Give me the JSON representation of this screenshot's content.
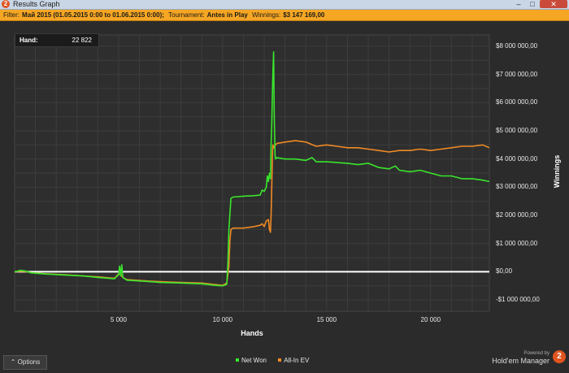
{
  "window": {
    "title": "Results Graph",
    "icon": "holdem-manager-icon"
  },
  "filterbar": {
    "filter_label": "Filter:",
    "filter_value": "Май 2015 (01.05.2015 0:00 to 01.06.2015 0:00);",
    "tournament_label": "Tournament:",
    "tournament_value": "Antes in Play",
    "winnings_label": "Winnings:",
    "winnings_value": "$3 147 169,00"
  },
  "hand_box": {
    "label": "Hand:",
    "value": "22 822"
  },
  "bottombar": {
    "options_label": "⌃  Options",
    "powered_small": "Powered by",
    "powered_brand": "Hold'em Manager",
    "logo_text": "2"
  },
  "colors": {
    "net_won": "#39e52c",
    "all_in_ev": "#f08a24",
    "accent": "#f5a623"
  },
  "chart_data": {
    "type": "line",
    "xlabel": "Hands",
    "ylabel": "Winnings",
    "xlim": [
      0,
      22822
    ],
    "ylim": [
      -1400000,
      8400000
    ],
    "x_ticks": [
      5000,
      10000,
      15000,
      20000
    ],
    "x_tick_labels": [
      "5 000",
      "10 000",
      "15 000",
      "20 000"
    ],
    "y_ticks": [
      -1000000,
      0,
      1000000,
      2000000,
      3000000,
      4000000,
      5000000,
      6000000,
      7000000,
      8000000
    ],
    "y_tick_labels": [
      "-$1 000 000,00",
      "$0,00",
      "$1 000 000,00",
      "$2 000 000,00",
      "$3 000 000,00",
      "$4 000 000,00",
      "$5 000 000,00",
      "$6 000 000,00",
      "$7 000 000,00",
      "$8 000 000,00"
    ],
    "grid": true,
    "legend_position": "bottom-center",
    "series": [
      {
        "name": "Net Won",
        "x": [
          0,
          300,
          500,
          800,
          1500,
          2500,
          3300,
          4000,
          4800,
          5000,
          5050,
          5100,
          5150,
          5200,
          5400,
          6500,
          7000,
          8000,
          9000,
          9600,
          10000,
          10200,
          10250,
          10300,
          10400,
          10500,
          11000,
          11500,
          11800,
          11900,
          12000,
          12100,
          12150,
          12200,
          12250,
          12300,
          12330,
          12360,
          12390,
          12420,
          12450,
          12480,
          12520,
          12550,
          12600,
          13000,
          13500,
          14000,
          14300,
          14500,
          15000,
          16000,
          16500,
          17000,
          17500,
          18000,
          18300,
          18500,
          19000,
          19500,
          20000,
          20500,
          21000,
          21500,
          22000,
          22500,
          22822
        ],
        "y": [
          0,
          50000,
          30000,
          -40000,
          -80000,
          -120000,
          -150000,
          -200000,
          -250000,
          -100000,
          200000,
          -150000,
          250000,
          -200000,
          -300000,
          -350000,
          -380000,
          -400000,
          -430000,
          -480000,
          -500000,
          -450000,
          300000,
          1500000,
          2600000,
          2650000,
          2680000,
          2700000,
          2720000,
          2900000,
          2850000,
          3000000,
          3400000,
          3200000,
          3500000,
          3300000,
          4500000,
          5200000,
          6300000,
          7100000,
          7800000,
          5500000,
          4100000,
          4000000,
          4050000,
          4000000,
          4000000,
          3950000,
          4050000,
          3900000,
          3900000,
          3850000,
          3800000,
          3850000,
          3700000,
          3650000,
          3750000,
          3600000,
          3550000,
          3600000,
          3500000,
          3400000,
          3400000,
          3300000,
          3300000,
          3250000,
          3200000
        ]
      },
      {
        "name": "All-In EV",
        "x": [
          0,
          300,
          500,
          800,
          1500,
          2500,
          3300,
          4000,
          4800,
          5000,
          5100,
          5200,
          5400,
          6500,
          7000,
          8000,
          9000,
          9600,
          10000,
          10200,
          10300,
          10350,
          10400,
          10500,
          11000,
          11500,
          11800,
          11900,
          12000,
          12100,
          12200,
          12250,
          12300,
          12330,
          12360,
          12400,
          12420,
          12460,
          12500,
          12550,
          12600,
          13000,
          13500,
          14000,
          14500,
          15000,
          15500,
          16000,
          16500,
          17000,
          17500,
          18000,
          18500,
          19000,
          19500,
          20000,
          20500,
          21000,
          21500,
          22000,
          22500,
          22822
        ],
        "y": [
          0,
          20000,
          10000,
          -30000,
          -70000,
          -110000,
          -150000,
          -180000,
          -230000,
          -80000,
          -100000,
          -200000,
          -280000,
          -330000,
          -350000,
          -380000,
          -400000,
          -450000,
          -480000,
          -400000,
          200000,
          1100000,
          1500000,
          1550000,
          1550000,
          1600000,
          1650000,
          1700000,
          1600000,
          1800000,
          1850000,
          1500000,
          1400000,
          2000000,
          3000000,
          4300000,
          4500000,
          4400000,
          4450000,
          4500000,
          4550000,
          4600000,
          4650000,
          4600000,
          4450000,
          4500000,
          4450000,
          4400000,
          4400000,
          4350000,
          4300000,
          4250000,
          4300000,
          4300000,
          4350000,
          4300000,
          4350000,
          4400000,
          4450000,
          4450000,
          4500000,
          4400000
        ]
      }
    ]
  }
}
